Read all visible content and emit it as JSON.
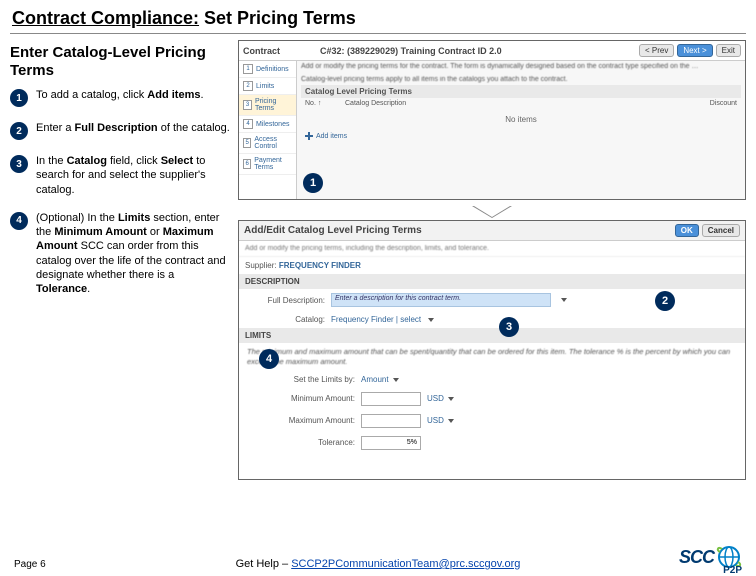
{
  "title_underline": "Contract Compliance:",
  "title_rest": " Set Pricing Terms",
  "subheading": "Enter Catalog-Level Pricing Terms",
  "steps": [
    {
      "n": "1",
      "html": "To add a catalog, click <b>Add items</b>."
    },
    {
      "n": "2",
      "html": "Enter a <b>Full Description</b> of the catalog."
    },
    {
      "n": "3",
      "html": "In the <b>Catalog</b> field, click <b>Select</b> to search for and select the supplier's catalog."
    },
    {
      "n": "4",
      "html": "(Optional) In the <b>Limits</b> section, enter the <b>Minimum Amount</b> or <b>Maximum Amount</b> SCC can order from this catalog over the life of the contract and designate whether there is a <b>Tolerance</b>."
    }
  ],
  "top_panel": {
    "contract_title": "C#32: (389229029) Training Contract ID 2.0",
    "prev": "< Prev",
    "next": "Next >",
    "exit": "Exit",
    "tabs": [
      {
        "n": "1",
        "label": "Definitions"
      },
      {
        "n": "2",
        "label": "Limits"
      },
      {
        "n": "3",
        "label": "Pricing Terms"
      },
      {
        "n": "4",
        "label": "Milestones"
      },
      {
        "n": "5",
        "label": "Access Control"
      },
      {
        "n": "6",
        "label": "Payment Terms"
      }
    ],
    "blurb1": "Add or modify the pricing terms for the contract. The form is dynamically designed based on the contract type specified on the …",
    "blurb2": "Catalog-level pricing terms apply to all items in the catalogs you attach to the contract.",
    "section_title": "Catalog Level Pricing Terms",
    "col1": "No. ↑",
    "col2": "Catalog  Description",
    "col3": "Discount",
    "noitems": "No items",
    "add_items": "Add items"
  },
  "bottom_panel": {
    "title": "Add/Edit Catalog Level Pricing Terms",
    "ok": "OK",
    "cancel": "Cancel",
    "sub": "Add or modify the pricing terms, including the description, limits, and tolerance.",
    "supplier_label": "Supplier:",
    "supplier_value": "FREQUENCY FINDER",
    "desc_header": "DESCRIPTION",
    "full_desc_label": "Full Description:",
    "full_desc_placeholder": "Enter a description for this contract term.",
    "catalog_label": "Catalog:",
    "catalog_value": "Frequency Finder | select",
    "limits_header": "LIMITS",
    "limits_desc": "The minimum and maximum amount that can be spent/quantity that can be ordered for this item. The tolerance % is the percent by which you can exceed the maximum amount.",
    "set_label": "Set the Limits by:",
    "set_value": "Amount",
    "min_label": "Minimum Amount:",
    "max_label": "Maximum Amount:",
    "usd": "USD",
    "tol_label": "Tolerance:",
    "tol_value": "5%"
  },
  "callouts": {
    "c1": "1",
    "c2": "2",
    "c3": "3",
    "c4": "4"
  },
  "footer": {
    "page": "Page 6",
    "help_prefix": "Get Help – ",
    "help_link": "SCCP2PCommunicationTeam@prc.sccgov.org",
    "logo_text": "SCC",
    "p2p": "P2P"
  }
}
